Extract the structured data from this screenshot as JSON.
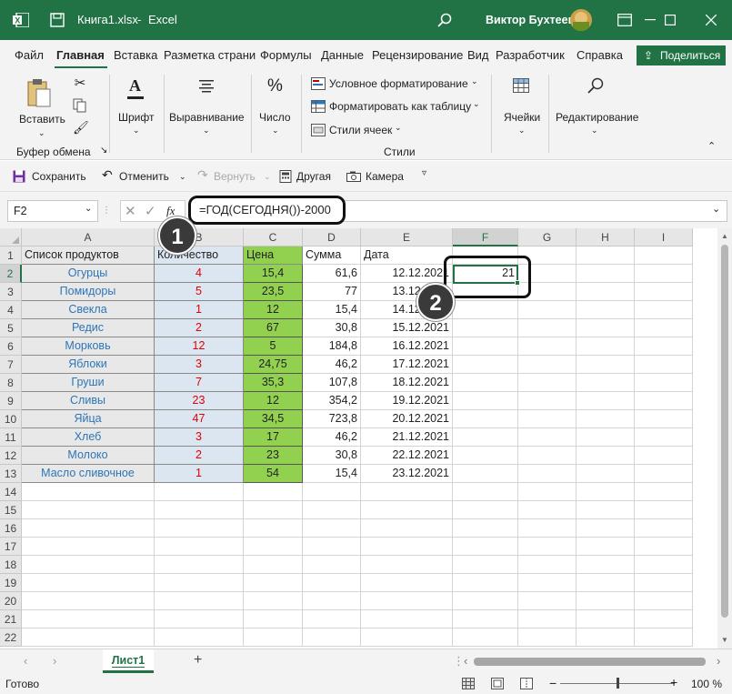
{
  "titlebar": {
    "filename": "Книга1.xlsx",
    "separator": "-",
    "app": "Excel",
    "user": "Виктор Бухтеев",
    "icons": {
      "app": "excel-icon",
      "save": "save-icon",
      "search": "search-icon"
    }
  },
  "tabs": [
    "Файл",
    "Главная",
    "Вставка",
    "Разметка страни",
    "Формулы",
    "Данные",
    "Рецензирование",
    "Вид",
    "Разработчик",
    "Справка"
  ],
  "share_label": "Поделиться",
  "ribbon": {
    "paste": "Вставить",
    "clipboard_group": "Буфер обмена",
    "font": "Шрифт",
    "alignment": "Выравнивание",
    "number": "Число",
    "conditional": "Условное форматирование",
    "format_table": "Форматировать как таблицу",
    "cell_styles": "Стили ячеек",
    "styles_group": "Стили",
    "cells": "Ячейки",
    "editing": "Редактирование"
  },
  "qat": {
    "save": "Сохранить",
    "undo": "Отменить",
    "redo": "Вернуть",
    "other": "Другая",
    "camera": "Камера"
  },
  "formula_bar": {
    "name_box": "F2",
    "fx": "fx",
    "formula": "=ГОД(СЕГОДНЯ())-2000"
  },
  "columns": [
    "A",
    "B",
    "C",
    "D",
    "E",
    "F",
    "G",
    "H",
    "I"
  ],
  "rows": [
    "1",
    "2",
    "3",
    "4",
    "5",
    "6",
    "7",
    "8",
    "9",
    "10",
    "11",
    "12",
    "13",
    "14",
    "15",
    "16",
    "17",
    "18",
    "19",
    "20",
    "21",
    "22"
  ],
  "headers": {
    "a": "Список продуктов",
    "b": "Количество",
    "c": "Цена",
    "d": "Сумма",
    "e": "Дата"
  },
  "data": [
    {
      "name": "Огурцы",
      "qty": "4",
      "price": "15,4",
      "sum": "61,6",
      "date": "12.12.2021"
    },
    {
      "name": "Помидоры",
      "qty": "5",
      "price": "23,5",
      "sum": "77",
      "date": "13.12.2021"
    },
    {
      "name": "Свекла",
      "qty": "1",
      "price": "12",
      "sum": "15,4",
      "date": "14.12.2021"
    },
    {
      "name": "Редис",
      "qty": "2",
      "price": "67",
      "sum": "30,8",
      "date": "15.12.2021"
    },
    {
      "name": "Морковь",
      "qty": "12",
      "price": "5",
      "sum": "184,8",
      "date": "16.12.2021"
    },
    {
      "name": "Яблоки",
      "qty": "3",
      "price": "24,75",
      "sum": "46,2",
      "date": "17.12.2021"
    },
    {
      "name": "Груши",
      "qty": "7",
      "price": "35,3",
      "sum": "107,8",
      "date": "18.12.2021"
    },
    {
      "name": "Сливы",
      "qty": "23",
      "price": "12",
      "sum": "354,2",
      "date": "19.12.2021"
    },
    {
      "name": "Яйца",
      "qty": "47",
      "price": "34,5",
      "sum": "723,8",
      "date": "20.12.2021"
    },
    {
      "name": "Хлеб",
      "qty": "3",
      "price": "17",
      "sum": "46,2",
      "date": "21.12.2021"
    },
    {
      "name": "Молоко",
      "qty": "2",
      "price": "23",
      "sum": "30,8",
      "date": "22.12.2021"
    },
    {
      "name": "Масло сливочное",
      "qty": "1",
      "price": "54",
      "sum": "15,4",
      "date": "23.12.2021"
    }
  ],
  "active_cell_value": "21",
  "callouts": [
    "1",
    "2"
  ],
  "sheet_tab": "Лист1",
  "add_sheet": "+",
  "status": {
    "ready": "Готово",
    "zoom": "100 %",
    "minus": "−",
    "plus": "+"
  },
  "colors": {
    "accent": "#217346",
    "name_text": "#2e75b6",
    "qty_text": "#e00000",
    "col_a_fill": "#e8e8e8",
    "col_b_fill": "#dce6f1",
    "col_c_fill": "#92d050"
  }
}
